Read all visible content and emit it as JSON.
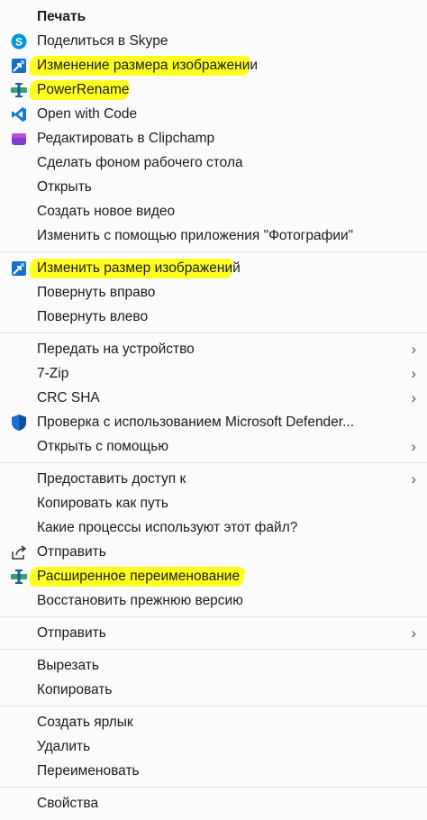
{
  "menu": {
    "groups": [
      {
        "items": [
          {
            "label": "Печать",
            "icon": "none",
            "bold": true
          },
          {
            "label": "Поделиться в Skype",
            "icon": "skype-icon"
          },
          {
            "label": "Изменение размера изображении",
            "icon": "image-resize-icon",
            "highlighted": true
          },
          {
            "label": "PowerRename",
            "icon": "powerrename-icon",
            "highlighted": true
          },
          {
            "label": "Open with Code",
            "icon": "vscode-icon"
          },
          {
            "label": "Редактировать в Clipchamp",
            "icon": "clipchamp-icon"
          },
          {
            "label": "Сделать фоном рабочего стола",
            "icon": "none"
          },
          {
            "label": "Открыть",
            "icon": "none"
          },
          {
            "label": "Создать новое видео",
            "icon": "none"
          },
          {
            "label": "Изменить с помощью приложения \"Фотографии\"",
            "icon": "none"
          }
        ]
      },
      {
        "items": [
          {
            "label": "Изменить размер изображений",
            "icon": "image-resize-icon",
            "highlighted": true
          },
          {
            "label": "Повернуть вправо",
            "icon": "none"
          },
          {
            "label": "Повернуть влево",
            "icon": "none"
          }
        ]
      },
      {
        "items": [
          {
            "label": "Передать на устройство",
            "icon": "none",
            "submenu": true
          },
          {
            "label": "7-Zip",
            "icon": "none",
            "submenu": true
          },
          {
            "label": "CRC SHA",
            "icon": "none",
            "submenu": true
          },
          {
            "label": "Проверка с использованием Microsoft Defender...",
            "icon": "defender-shield-icon"
          },
          {
            "label": "Открыть с помощью",
            "icon": "none",
            "submenu": true
          }
        ]
      },
      {
        "items": [
          {
            "label": "Предоставить доступ к",
            "icon": "none",
            "submenu": true
          },
          {
            "label": "Копировать как путь",
            "icon": "none"
          },
          {
            "label": "Какие процессы используют этот файл?",
            "icon": "none"
          },
          {
            "label": "Отправить",
            "icon": "share-icon"
          },
          {
            "label": "Расширенное переименование",
            "icon": "powerrename-icon",
            "highlighted": true
          },
          {
            "label": "Восстановить прежнюю версию",
            "icon": "none"
          }
        ]
      },
      {
        "items": [
          {
            "label": "Отправить",
            "icon": "none",
            "submenu": true
          }
        ]
      },
      {
        "items": [
          {
            "label": "Вырезать",
            "icon": "none"
          },
          {
            "label": "Копировать",
            "icon": "none"
          }
        ]
      },
      {
        "items": [
          {
            "label": "Создать ярлык",
            "icon": "none"
          },
          {
            "label": "Удалить",
            "icon": "none"
          },
          {
            "label": "Переименовать",
            "icon": "none"
          }
        ]
      },
      {
        "items": [
          {
            "label": "Свойства",
            "icon": "none"
          }
        ]
      }
    ],
    "chevron": "›",
    "highlight_color": "#ffff1f"
  }
}
